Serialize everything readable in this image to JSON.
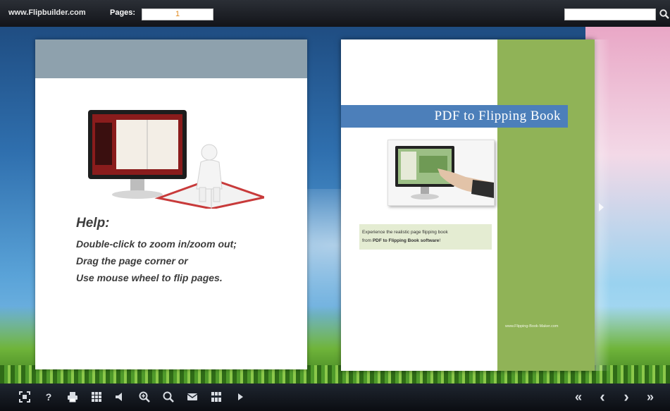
{
  "topbar": {
    "brand": "www.Flipbuilder.com",
    "pages_label": "Pages:",
    "page_value": "1",
    "search_placeholder": ""
  },
  "left_page": {
    "help_title": "Help:",
    "help_lines": [
      "Double-click to zoom in/zoom out;",
      "Drag the page corner or",
      "Use mouse wheel to flip pages."
    ]
  },
  "right_page": {
    "title": "PDF to Flipping Book",
    "desc_line1": "Experience the realistic page flipping book",
    "desc_line2_prefix": "from ",
    "desc_line2_bold": "PDF to Flipping Book software",
    "desc_line2_suffix": "!",
    "site": "www.Flipping-Book-Maker.com"
  },
  "toolbar": {
    "fullscreen": "fullscreen-icon",
    "help": "?",
    "print": "print-icon",
    "thumbnails": "grid-icon",
    "sound": "speaker-icon",
    "zoom_in": "zoom-in-icon",
    "search": "search-icon",
    "email": "email-icon",
    "share": "share-icon",
    "autoplay": "play-icon",
    "first": "«",
    "prev": "‹",
    "next": "›",
    "last": "»"
  },
  "colors": {
    "green": "#90b357",
    "title_blue": "#4c7fba",
    "page_number": "#e08a1e"
  }
}
